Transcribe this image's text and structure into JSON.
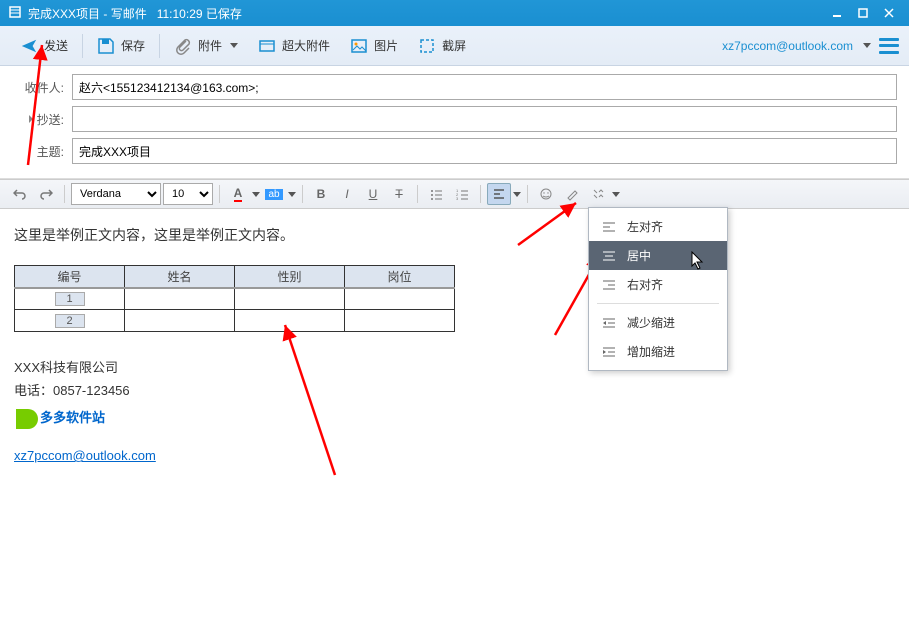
{
  "title": {
    "doc": "完成XXX项目",
    "mode": "写邮件",
    "time": "11:10:29",
    "status": "已保存"
  },
  "toolbar": {
    "send": "发送",
    "save": "保存",
    "attach": "附件",
    "bigattach": "超大附件",
    "image": "图片",
    "screenshot": "截屏",
    "account": "xz7pccom@outlook.com"
  },
  "fields": {
    "to_label": "收件人:",
    "to_value": "赵六<155123412134@163.com>;",
    "cc_label": "抄送:",
    "cc_value": "",
    "subject_label": "主题:",
    "subject_value": "完成XXX项目"
  },
  "format": {
    "font": "Verdana",
    "size": "10"
  },
  "body": {
    "text": "这里是举例正文内容，这里是举例正文内容。",
    "table": {
      "headers": [
        "编号",
        "姓名",
        "性别",
        "岗位"
      ],
      "rows": [
        [
          "1",
          "",
          "",
          ""
        ],
        [
          "2",
          "",
          "",
          ""
        ]
      ]
    },
    "sig": {
      "company": "XXX科技有限公司",
      "phone": "电话：0857-123456",
      "logo_text": "多多软件站",
      "email": "xz7pccom@outlook.com"
    }
  },
  "menu": {
    "items": [
      {
        "label": "左对齐",
        "icon": "align-left"
      },
      {
        "label": "居中",
        "icon": "align-center"
      },
      {
        "label": "右对齐",
        "icon": "align-right"
      },
      {
        "label": "减少缩进",
        "icon": "outdent"
      },
      {
        "label": "增加缩进",
        "icon": "indent"
      }
    ]
  }
}
